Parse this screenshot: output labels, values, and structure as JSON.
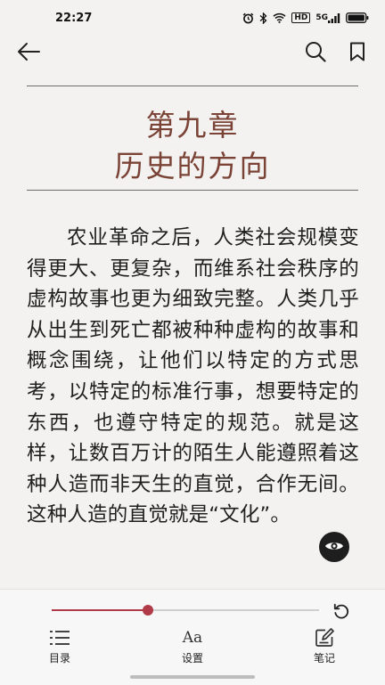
{
  "status_bar": {
    "time": "22:27",
    "icons": [
      "alarm-icon",
      "bluetooth-icon",
      "wifi-icon",
      "hd-icon",
      "signal-icon",
      "battery-icon"
    ],
    "hd_text": "HD",
    "signal_text": "5G"
  },
  "toolbar": {
    "icons": [
      "back-arrow-icon",
      "search-icon",
      "bookmark-icon"
    ]
  },
  "chapter": {
    "number": "第九章",
    "title": "历史的方向",
    "title_color": "#7a4336"
  },
  "content": {
    "paragraph": "农业革命之后，人类社会规模变得更大、更复杂，而维系社会秩序的虚构故事也更为细致完整。人类几乎从出生到死亡都被种种虚构的故事和概念围绕，让他们以特定的方式思考，以特定的标准行事，想要特定的东西，也遵守特定的规范。就是这样，让数百万计的陌生人能遵照着这种人造而非天生的直觉，合作无间。这种人造的直觉就是“文化”。"
  },
  "reader_controls": {
    "progress": 0.36,
    "accent_color": "#b03a48"
  },
  "bottom_nav": {
    "items": [
      {
        "label": "目录",
        "icon": "list-icon"
      },
      {
        "label": "设置",
        "icon": "font-settings-icon",
        "icon_text": "Aa"
      },
      {
        "label": "笔记",
        "icon": "note-edit-icon"
      }
    ]
  }
}
